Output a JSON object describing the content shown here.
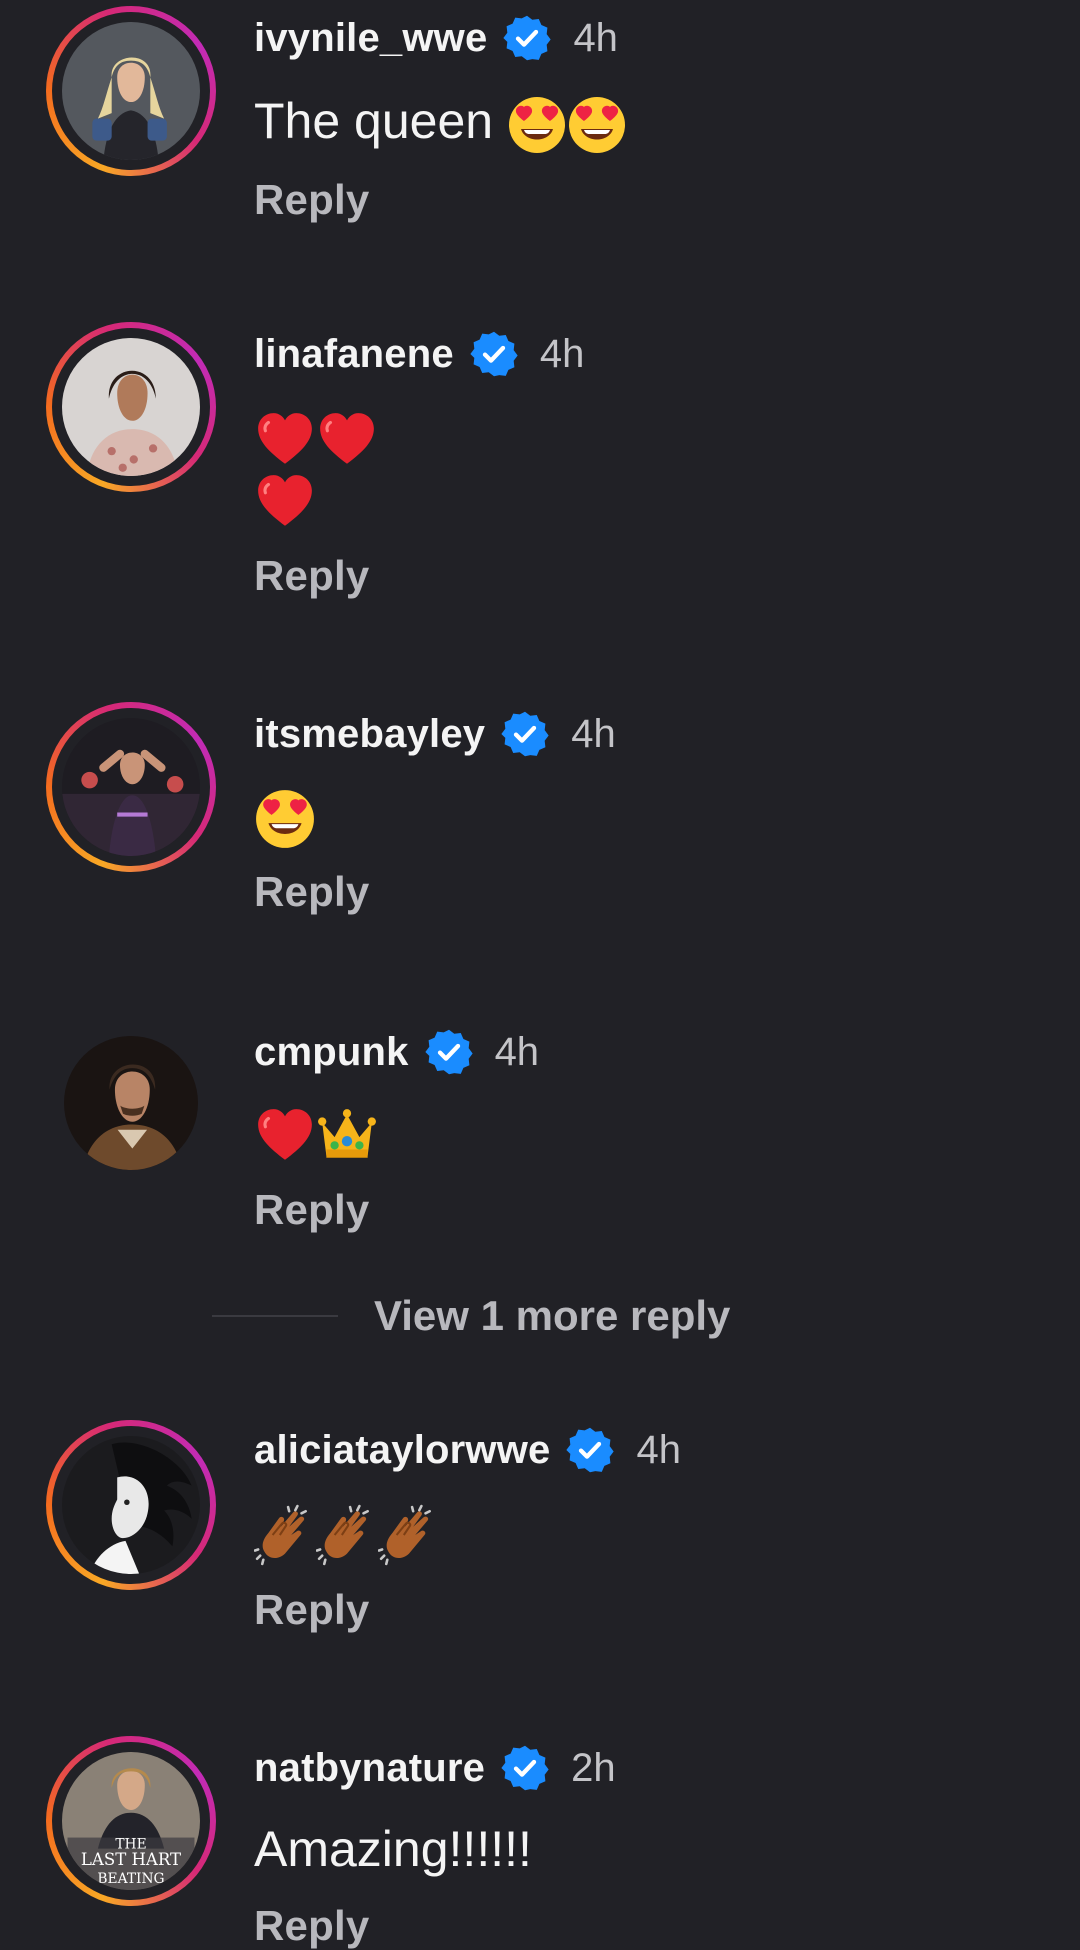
{
  "comments": [
    {
      "username": "ivynile_wwe",
      "time": "4h",
      "text": "The queen",
      "reply_label": "Reply"
    },
    {
      "username": "linafanene",
      "time": "4h",
      "text": "",
      "reply_label": "Reply"
    },
    {
      "username": "itsmebayley",
      "time": "4h",
      "text": "",
      "reply_label": "Reply"
    },
    {
      "username": "cmpunk",
      "time": "4h",
      "text": "",
      "reply_label": "Reply",
      "view_more": "View 1 more reply"
    },
    {
      "username": "aliciataylorwwe",
      "time": "4h",
      "text": "",
      "reply_label": "Reply"
    },
    {
      "username": "natbynature",
      "time": "2h",
      "text": "Amazing!!!!!!",
      "reply_label": "Reply",
      "avatar_text": [
        "THE",
        "LAST HART",
        "BEATING"
      ]
    }
  ],
  "icons": {
    "verified": "verified-badge-icon",
    "heart_eyes": "heart-eyes-emoji",
    "heart": "red-heart-emoji",
    "crown": "crown-emoji",
    "clap": "clapping-hands-emoji"
  },
  "colors": {
    "background": "#212126",
    "verified_blue": "#1a8cff",
    "ring_gradient": [
      "#f9a825",
      "#d62976",
      "#c22bb6"
    ]
  }
}
